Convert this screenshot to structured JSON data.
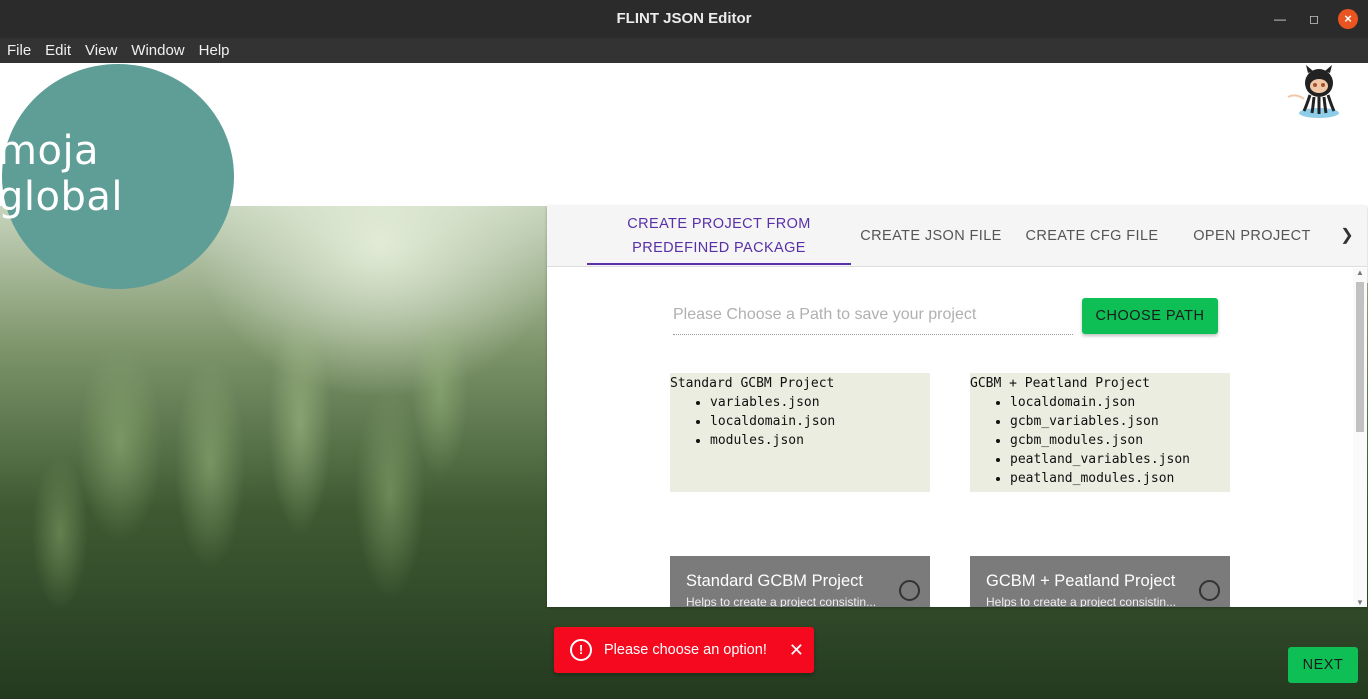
{
  "window": {
    "title": "FLINT JSON Editor"
  },
  "menu": [
    "File",
    "Edit",
    "View",
    "Window",
    "Help"
  ],
  "logo": {
    "text": "moja global",
    "color": "#5f9e97"
  },
  "tabs": [
    {
      "label": "CREATE PROJECT FROM PREDEFINED PACKAGE",
      "active": true
    },
    {
      "label": "CREATE JSON FILE",
      "active": false
    },
    {
      "label": "CREATE CFG FILE",
      "active": false
    },
    {
      "label": "OPEN PROJECT",
      "active": false
    }
  ],
  "path": {
    "placeholder": "Please Choose a Path to save your project",
    "button": "CHOOSE PATH"
  },
  "packages": [
    {
      "title": "Standard GCBM Project",
      "files": [
        "variables.json",
        "localdomain.json",
        "modules.json"
      ],
      "card_title": "Standard GCBM Project",
      "card_subtitle": "Helps to create a project consistin..."
    },
    {
      "title": "GCBM + Peatland Project",
      "files": [
        "localdomain.json",
        "gcbm_variables.json",
        "gcbm_modules.json",
        "peatland_variables.json",
        "peatland_modules.json"
      ],
      "card_title": "GCBM + Peatland Project",
      "card_subtitle": "Helps to create a project consistin..."
    }
  ],
  "toast": {
    "message": "Please choose an option!",
    "color": "#f5091f"
  },
  "next_button": "NEXT",
  "colors": {
    "accent": "#5930a8",
    "button_green": "#0dbf55"
  }
}
